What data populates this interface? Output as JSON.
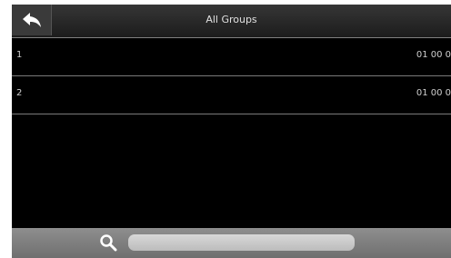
{
  "header": {
    "title": "All Groups",
    "back_icon": "back-arrow-icon"
  },
  "groups": [
    {
      "name": "1",
      "value": "01 00 0"
    },
    {
      "name": "2",
      "value": "01 00 0"
    }
  ],
  "search": {
    "icon": "search-icon",
    "value": "",
    "placeholder": ""
  }
}
